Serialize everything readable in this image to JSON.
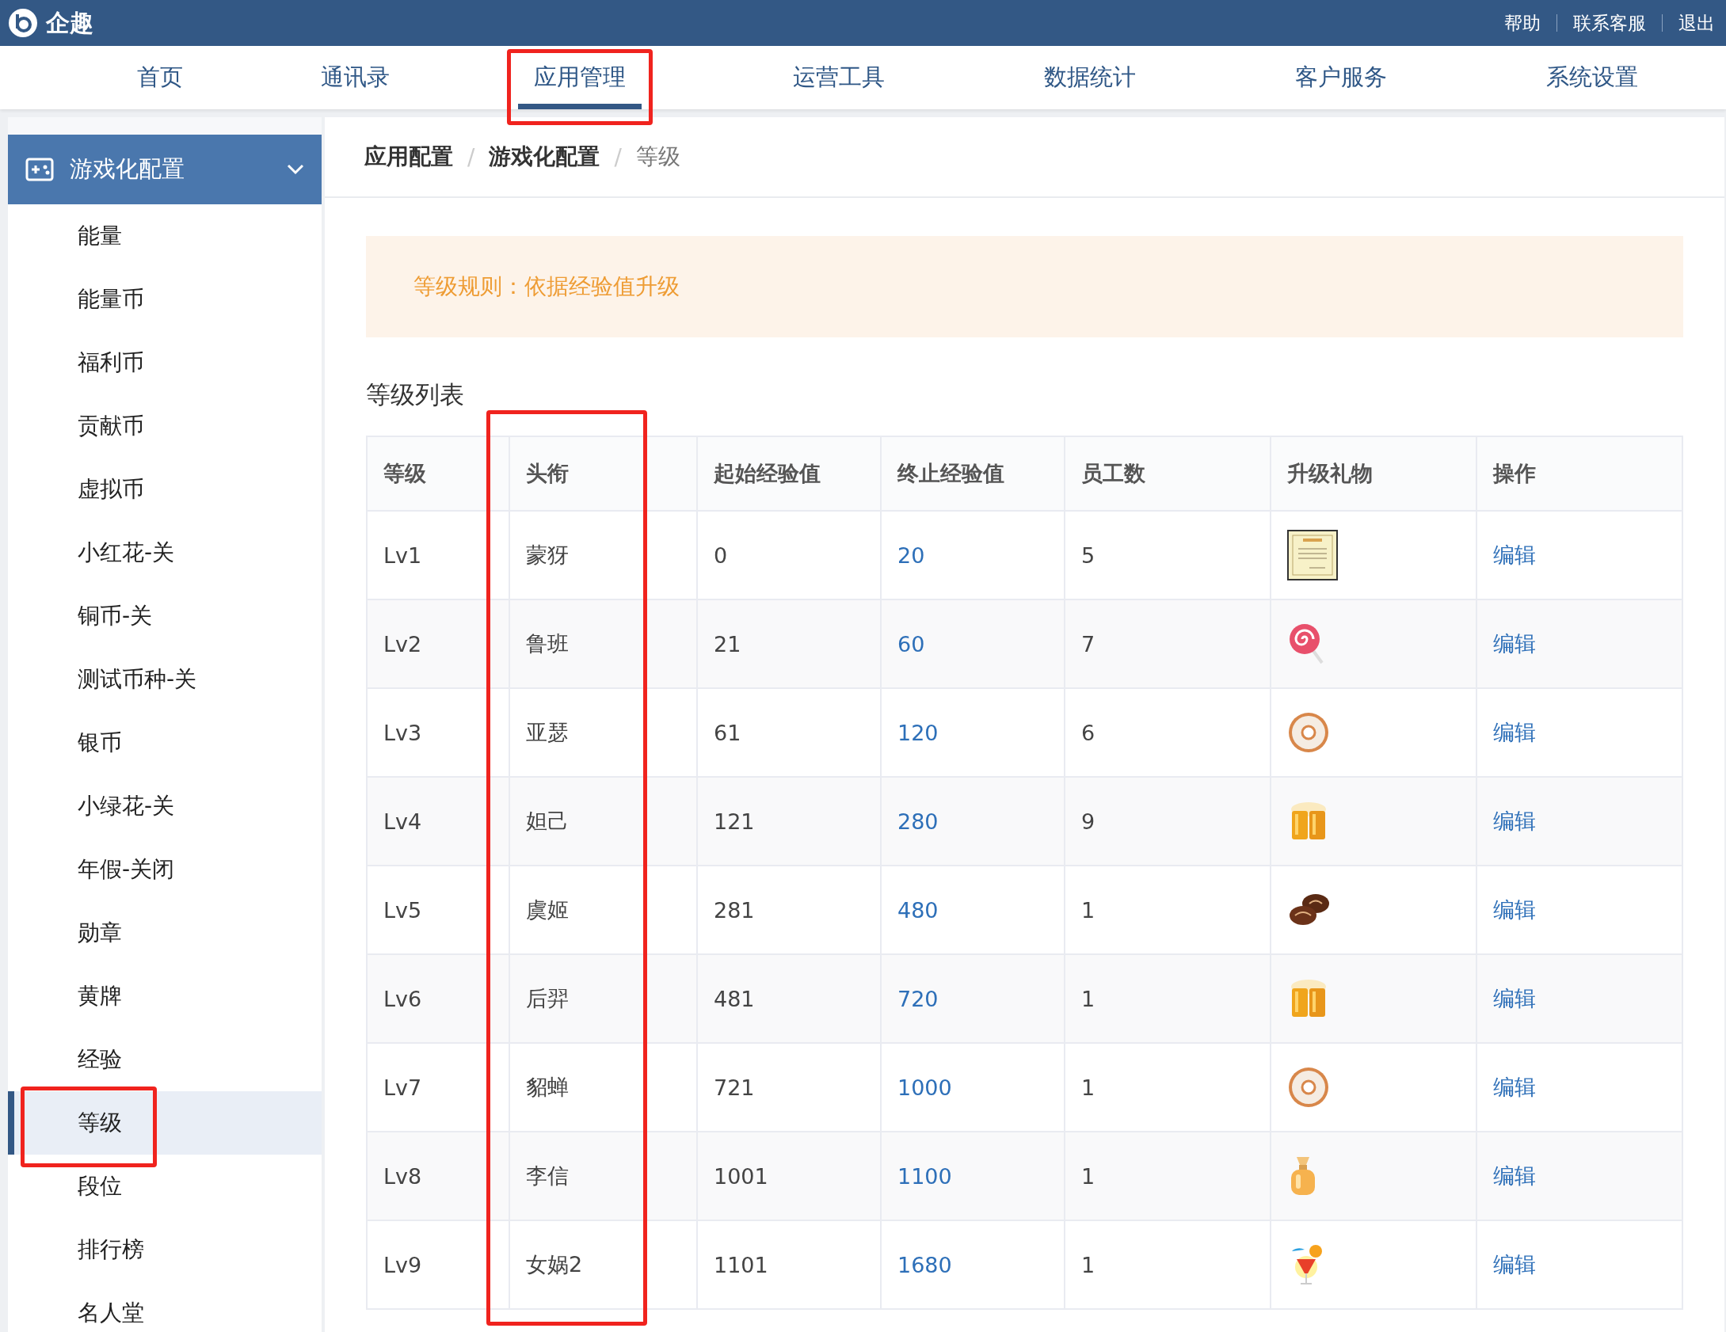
{
  "brand": {
    "name": "企趣"
  },
  "top_links": [
    "帮助",
    "联系客服",
    "退出"
  ],
  "nav": [
    {
      "label": "首页",
      "selected": false,
      "highlighted": false
    },
    {
      "label": "通讯录",
      "selected": false,
      "highlighted": false
    },
    {
      "label": "应用管理",
      "selected": true,
      "highlighted": true
    },
    {
      "label": "运营工具",
      "selected": false,
      "highlighted": false
    },
    {
      "label": "数据统计",
      "selected": false,
      "highlighted": false
    },
    {
      "label": "客户服务",
      "selected": false,
      "highlighted": false
    },
    {
      "label": "系统设置",
      "selected": false,
      "highlighted": false
    }
  ],
  "sidebar": {
    "group": {
      "label": "游戏化配置",
      "expanded": true
    },
    "items": [
      {
        "label": "能量",
        "selected": false,
        "highlighted": false
      },
      {
        "label": "能量币",
        "selected": false,
        "highlighted": false
      },
      {
        "label": "福利币",
        "selected": false,
        "highlighted": false
      },
      {
        "label": "贡献币",
        "selected": false,
        "highlighted": false
      },
      {
        "label": "虚拟币",
        "selected": false,
        "highlighted": false
      },
      {
        "label": "小红花-关",
        "selected": false,
        "highlighted": false
      },
      {
        "label": "铜币-关",
        "selected": false,
        "highlighted": false
      },
      {
        "label": "测试币种-关",
        "selected": false,
        "highlighted": false
      },
      {
        "label": "银币",
        "selected": false,
        "highlighted": false
      },
      {
        "label": "小绿花-关",
        "selected": false,
        "highlighted": false
      },
      {
        "label": "年假-关闭",
        "selected": false,
        "highlighted": false
      },
      {
        "label": "勋章",
        "selected": false,
        "highlighted": false
      },
      {
        "label": "黄牌",
        "selected": false,
        "highlighted": false
      },
      {
        "label": "经验",
        "selected": false,
        "highlighted": false
      },
      {
        "label": "等级",
        "selected": true,
        "highlighted": true
      },
      {
        "label": "段位",
        "selected": false,
        "highlighted": false
      },
      {
        "label": "排行榜",
        "selected": false,
        "highlighted": false
      },
      {
        "label": "名人堂",
        "selected": false,
        "highlighted": false
      }
    ]
  },
  "breadcrumb": {
    "items": [
      "应用配置",
      "游戏化配置",
      "等级"
    ],
    "separator": "/"
  },
  "notice": "等级规则：依据经验值升级",
  "section_title": "等级列表",
  "table": {
    "columns": [
      {
        "label": "等级",
        "highlighted": false
      },
      {
        "label": "头衔",
        "highlighted": true
      },
      {
        "label": "起始经验值",
        "highlighted": false
      },
      {
        "label": "终止经验值",
        "highlighted": false
      },
      {
        "label": "员工数",
        "highlighted": false
      },
      {
        "label": "升级礼物",
        "highlighted": false
      },
      {
        "label": "操作",
        "highlighted": false
      }
    ],
    "rows": [
      {
        "level": "Lv1",
        "title": "蒙犽",
        "start": "0",
        "end": "20",
        "staff": "5",
        "kind": "certificate",
        "action": "编辑"
      },
      {
        "level": "Lv2",
        "title": "鲁班",
        "start": "21",
        "end": "60",
        "staff": "7",
        "kind": "lollipop",
        "action": "编辑"
      },
      {
        "level": "Lv3",
        "title": "亚瑟",
        "start": "61",
        "end": "120",
        "staff": "6",
        "kind": "donut",
        "action": "编辑"
      },
      {
        "level": "Lv4",
        "title": "妲己",
        "start": "121",
        "end": "280",
        "staff": "9",
        "kind": "beer",
        "action": "编辑"
      },
      {
        "level": "Lv5",
        "title": "虞姬",
        "start": "281",
        "end": "480",
        "staff": "1",
        "kind": "chocolate",
        "action": "编辑"
      },
      {
        "level": "Lv6",
        "title": "后羿",
        "start": "481",
        "end": "720",
        "staff": "1",
        "kind": "beer",
        "action": "编辑"
      },
      {
        "level": "Lv7",
        "title": "貂蝉",
        "start": "721",
        "end": "1000",
        "staff": "1",
        "kind": "donut",
        "action": "编辑"
      },
      {
        "level": "Lv8",
        "title": "李信",
        "start": "1001",
        "end": "1100",
        "staff": "1",
        "kind": "perfume",
        "action": "编辑"
      },
      {
        "level": "Lv9",
        "title": "女娲2",
        "start": "1101",
        "end": "1680",
        "staff": "1",
        "kind": "cocktail",
        "action": "编辑"
      }
    ]
  }
}
